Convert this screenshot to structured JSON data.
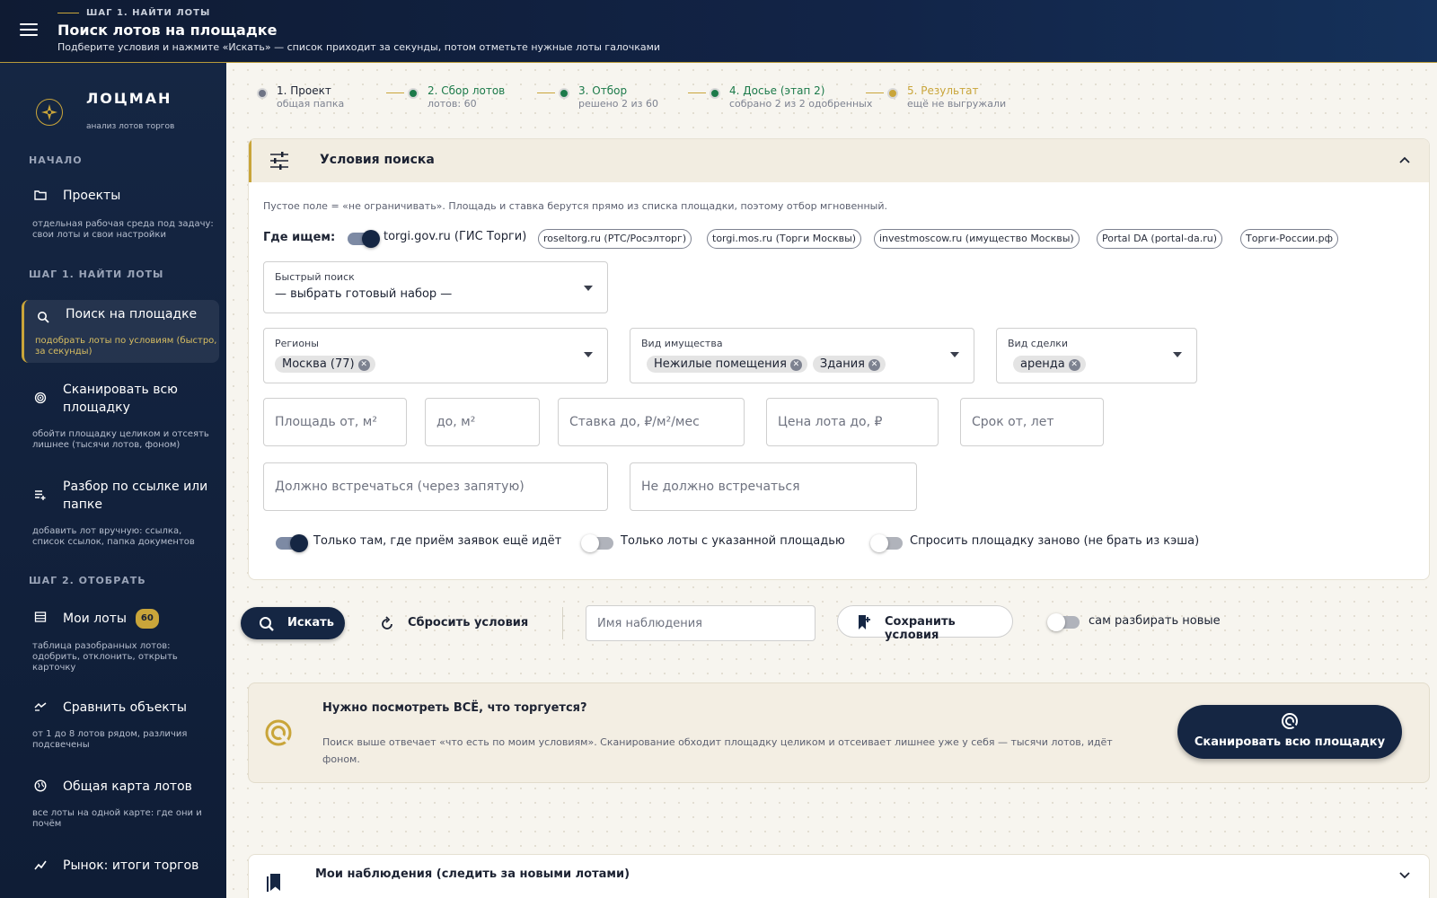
{
  "header": {
    "step_tag": "ШАГ 1. НАЙТИ ЛОТЫ",
    "title": "Поиск лотов на площадке",
    "subtitle": "Подберите условия и нажмите «Искать» — список приходит за секунды, потом отметьте нужные лоты галочками"
  },
  "sidebar": {
    "brand": "ЛОЦМАН",
    "brand_sub": "анализ лотов торгов",
    "sections": [
      "НАЧАЛО",
      "ШАГ 1. НАЙТИ ЛОТЫ",
      "ШАГ 2. ОТОБРАТЬ"
    ],
    "items": [
      {
        "label": "Проекты",
        "desc": "отдельная рабочая среда под задачу: свои лоты и свои настройки",
        "icon": "folder-icon"
      },
      {
        "label": "Поиск на площадке",
        "desc": "подобрать лоты по условиям (быстро, за секунды)",
        "icon": "search-icon",
        "active": true
      },
      {
        "label": "Сканировать всю площадку",
        "desc": "обойти площадку целиком и отсеять лишнее (тысячи лотов, фоном)",
        "icon": "radar-icon"
      },
      {
        "label": "Разбор по ссылке или папке",
        "desc": "добавить лот вручную: ссылка, список ссылок, папка документов",
        "icon": "add-list-icon"
      },
      {
        "label": "Мои лоты",
        "badge": "60",
        "desc": "таблица разобранных лотов: одобрить, отклонить, открыть карточку",
        "icon": "table-icon"
      },
      {
        "label": "Сравнить объекты",
        "desc": "от 1 до 8 лотов рядом, различия подсвечены",
        "icon": "compare-icon"
      },
      {
        "label": "Общая карта лотов",
        "desc": "все лоты на одной карте: где они и почём",
        "icon": "globe-icon"
      },
      {
        "label": "Рынок: итоги торгов",
        "icon": "chart-icon"
      }
    ]
  },
  "stepper": [
    {
      "title": "1. Проект",
      "sub": "общая папка",
      "state": "current"
    },
    {
      "title": "2. Сбор лотов",
      "sub": "лотов: 60",
      "state": "done"
    },
    {
      "title": "3. Отбор",
      "sub": "решено 2 из 60",
      "state": "done"
    },
    {
      "title": "4. Досье (этап 2)",
      "sub": "собрано 2 из 2 одобренных",
      "state": "done"
    },
    {
      "title": "5. Результат",
      "sub": "ещё не выгружали",
      "state": "pending"
    }
  ],
  "colors": {
    "accent": "#c9a53a",
    "navy": "#152643",
    "done": "#1c7a4a",
    "pending": "#c9a53a"
  },
  "search": {
    "panel_title": "Условия поиска",
    "hint": "Пустое поле = «не ограничивать». Площадь и ставка берутся прямо из списка площадки, поэтому отбор мгновенный.",
    "where_label": "Где ищем:",
    "main_source": "torgi.gov.ru (ГИС Торги)",
    "sources": [
      "roseltorg.ru (РТС/Росэлторг)",
      "torgi.mos.ru (Торги Москвы)",
      "investmoscow.ru (имущество Москвы)",
      "Portal DA (portal-da.ru)",
      "Торги-России.рф"
    ],
    "quick": {
      "label": "Быстрый поиск",
      "value": "— выбрать готовый набор —"
    },
    "regions": {
      "label": "Регионы",
      "tags": [
        "Москва (77)"
      ]
    },
    "property": {
      "label": "Вид имущества",
      "tags": [
        "Нежилые помещения",
        "Здания"
      ]
    },
    "deal": {
      "label": "Вид сделки",
      "tags": [
        "аренда"
      ]
    },
    "placeholders": {
      "area_from": "Площадь от, м²",
      "area_to": "до, м²",
      "rate_to": "Ставка до, ₽/м²/мес",
      "price_to": "Цена лота до, ₽",
      "term_from": "Срок от, лет",
      "must": "Должно встречаться (через запятую)",
      "must_not": "Не должно встречаться",
      "watch_name": "Имя наблюдения"
    },
    "toggles": [
      {
        "label": "Только там, где приём заявок ещё идёт",
        "on": true
      },
      {
        "label": "Только лоты с указанной площадью",
        "on": false
      },
      {
        "label": "Спросить площадку заново (не брать из кэша)",
        "on": false
      }
    ]
  },
  "actions": {
    "search": "Искать",
    "reset": "Сбросить условия",
    "save": "Сохранить условия",
    "auto_label": "сам разбирать новые"
  },
  "scan_card": {
    "heading": "Нужно посмотреть ВСЁ, что торгуется?",
    "desc": "Поиск выше отвечает «что есть по моим условиям». Сканирование обходит площадку целиком и отсеивает лишнее уже у себя — тысячи лотов, идёт фоном.",
    "button": "Сканировать всю площадку"
  },
  "watches": {
    "title": "Мои наблюдения (следить за новыми лотами)"
  }
}
